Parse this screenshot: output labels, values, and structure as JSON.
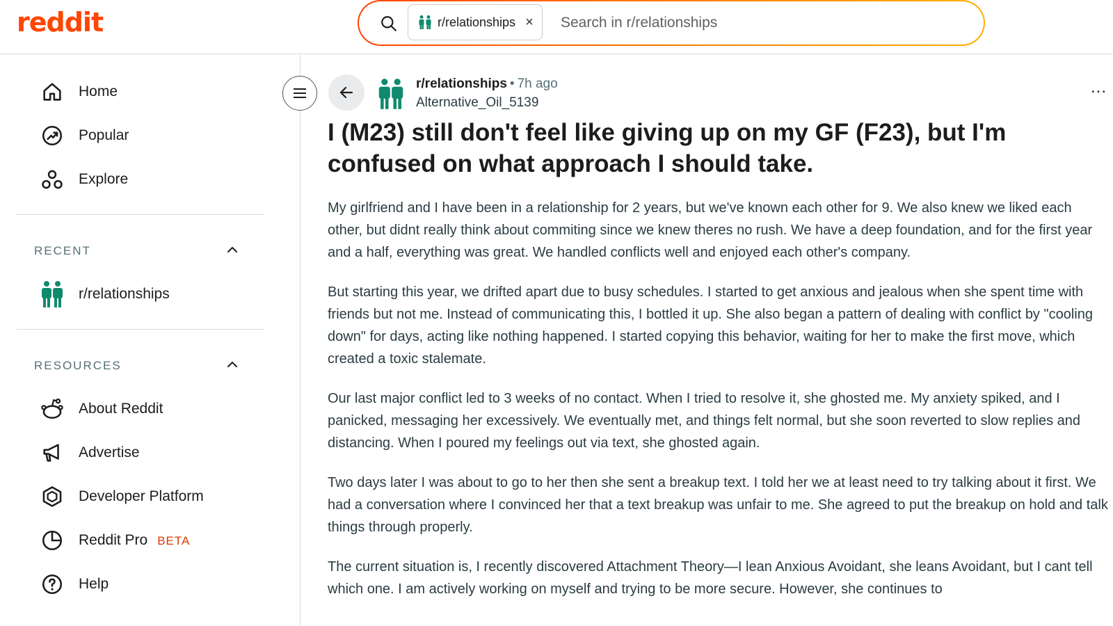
{
  "header": {
    "logo_text": "reddit",
    "search_chip_label": "r/relationships",
    "search_chip_close": "×",
    "search_placeholder": "Search in r/relationships"
  },
  "sidebar": {
    "nav": [
      {
        "label": "Home",
        "icon": "home-icon"
      },
      {
        "label": "Popular",
        "icon": "popular-icon"
      },
      {
        "label": "Explore",
        "icon": "explore-icon"
      }
    ],
    "recent": {
      "title": "RECENT",
      "items": [
        {
          "label": "r/relationships",
          "icon": "subreddit-icon"
        }
      ]
    },
    "resources": {
      "title": "RESOURCES",
      "items": [
        {
          "label": "About Reddit",
          "icon": "reddit-alien-icon"
        },
        {
          "label": "Advertise",
          "icon": "megaphone-icon"
        },
        {
          "label": "Developer Platform",
          "icon": "developer-icon"
        },
        {
          "label": "Reddit Pro",
          "badge": "BETA",
          "icon": "pro-icon"
        },
        {
          "label": "Help",
          "icon": "help-icon"
        }
      ]
    }
  },
  "post": {
    "subreddit": "r/relationships",
    "separator": "•",
    "time": "7h ago",
    "author": "Alternative_Oil_5139",
    "more": "...",
    "title": "I (M23) still don't feel like giving up on my GF (F23), but I'm confused on what approach I should take.",
    "paragraphs": [
      "My girlfriend and I have been in a relationship for 2 years, but we've known each other for 9. We also knew we liked each other, but didnt really think about commiting since we knew theres no rush. We have a deep foundation, and for the first year and a half, everything was great. We handled conflicts well and enjoyed each other's company.",
      "But starting this year, we drifted apart due to busy schedules. I started to get anxious and jealous when she spent time with friends but not me. Instead of communicating this, I bottled it up. She also began a pattern of dealing with conflict by \"cooling down\" for days, acting like nothing happened. I started copying this behavior, waiting for her to make the first move, which created a toxic stalemate.",
      "Our last major conflict led to 3 weeks of no contact. When I tried to resolve it, she ghosted me. My anxiety spiked, and I panicked, messaging her excessively. We eventually met, and things felt normal, but she soon reverted to slow replies and distancing. When I poured my feelings out via text, she ghosted again.",
      "Two days later I was about to go to her then she sent a breakup text. I told her we at least need to try talking about it first. We had a conversation where I convinced her that a text breakup was unfair to me. She agreed to put the breakup on hold and talk things through properly.",
      "The current situation is, I recently discovered Attachment Theory—I lean Anxious Avoidant, she leans Avoidant, but I cant tell which one. I am actively working on myself and trying to be more secure. However, she continues to"
    ]
  },
  "colors": {
    "brand": "#ff4500",
    "subreddit_icon": "#0f8a6e",
    "beta": "#d93a00"
  }
}
